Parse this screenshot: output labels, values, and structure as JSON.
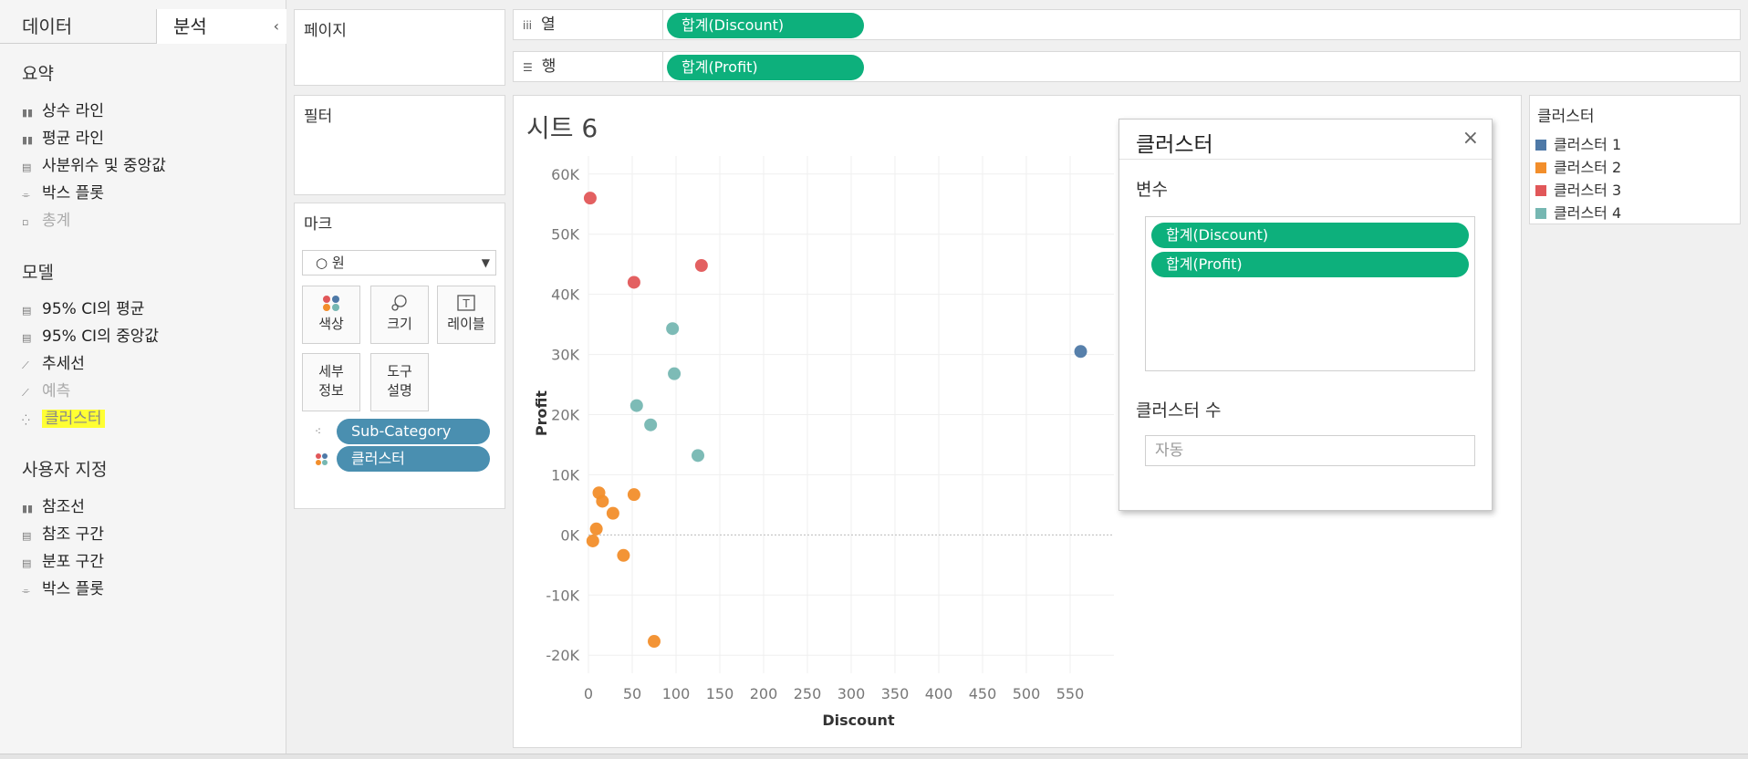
{
  "left_panel": {
    "tab_data": "데이터",
    "tab_analysis": "분석",
    "collapse": "‹",
    "summary": {
      "heading": "요약",
      "items": [
        {
          "label": "상수 라인",
          "enabled": true
        },
        {
          "label": "평균 라인",
          "enabled": true
        },
        {
          "label": "사분위수 및 중앙값",
          "enabled": true
        },
        {
          "label": "박스 플롯",
          "enabled": true
        },
        {
          "label": "총계",
          "enabled": false
        }
      ]
    },
    "model": {
      "heading": "모델",
      "items": [
        {
          "label": "95% CI의 평균",
          "enabled": true
        },
        {
          "label": "95% CI의 중앙값",
          "enabled": true
        },
        {
          "label": "추세선",
          "enabled": true
        },
        {
          "label": "예측",
          "enabled": false
        },
        {
          "label": "클러스터",
          "enabled": true,
          "highlighted": true
        }
      ]
    },
    "custom": {
      "heading": "사용자 지정",
      "items": [
        {
          "label": "참조선",
          "enabled": true
        },
        {
          "label": "참조 구간",
          "enabled": true
        },
        {
          "label": "분포 구간",
          "enabled": true
        },
        {
          "label": "박스 플롯",
          "enabled": true
        }
      ]
    }
  },
  "cards": {
    "pages": "페이지",
    "filters": "필터",
    "marks": {
      "title": "마크",
      "mark_type": "○ 원",
      "buttons": {
        "color": "색상",
        "size": "크기",
        "label": "레이블",
        "detail_1": "세부",
        "detail_2": "정보",
        "tooltip_1": "도구",
        "tooltip_2": "설명"
      },
      "pills": [
        "Sub-Category",
        "클러스터"
      ]
    }
  },
  "shelves": {
    "columns_label": "열",
    "columns_icon": "iii",
    "columns_pill": "합계(Discount)",
    "rows_label": "행",
    "rows_icon": "☰",
    "rows_pill": "합계(Profit)"
  },
  "sheet": {
    "title": "시트 6"
  },
  "legend": {
    "title": "클러스터",
    "items": [
      {
        "label": "클러스터 1",
        "color": "#4e79a7"
      },
      {
        "label": "클러스터 2",
        "color": "#f28e2b"
      },
      {
        "label": "클러스터 3",
        "color": "#e15759"
      },
      {
        "label": "클러스터 4",
        "color": "#76b7b2"
      }
    ]
  },
  "dialog": {
    "title": "클러스터",
    "close": "×",
    "variables_label": "변수",
    "variables": [
      "합계(Discount)",
      "합계(Profit)"
    ],
    "count_label": "클러스터 수",
    "count_placeholder": "자동"
  },
  "chart_data": {
    "type": "scatter",
    "xlabel": "Discount",
    "ylabel": "Profit",
    "xlim": [
      0,
      600
    ],
    "ylim": [
      -23000,
      63000
    ],
    "x_ticks": [
      "0",
      "50",
      "100",
      "150",
      "200",
      "250",
      "300",
      "350",
      "400",
      "450",
      "500",
      "550"
    ],
    "y_ticks": [
      "60K",
      "50K",
      "40K",
      "30K",
      "20K",
      "10K",
      "0K",
      "-10K",
      "-20K"
    ],
    "grid": true,
    "series": [
      {
        "name": "클러스터 1",
        "color": "#4e79a7",
        "points": [
          [
            562,
            30500
          ]
        ]
      },
      {
        "name": "클러스터 2",
        "color": "#f28e2b",
        "points": [
          [
            12,
            7000
          ],
          [
            16,
            5600
          ],
          [
            28,
            3600
          ],
          [
            52,
            6700
          ],
          [
            9,
            1000
          ],
          [
            5,
            -1000
          ],
          [
            40,
            -3400
          ],
          [
            75,
            -17700
          ]
        ]
      },
      {
        "name": "클러스터 3",
        "color": "#e15759",
        "points": [
          [
            2,
            56000
          ],
          [
            52,
            42000
          ],
          [
            129,
            44800
          ]
        ]
      },
      {
        "name": "클러스터 4",
        "color": "#76b7b2",
        "points": [
          [
            96,
            34300
          ],
          [
            98,
            26800
          ],
          [
            55,
            21500
          ],
          [
            71,
            18300
          ],
          [
            125,
            13200
          ]
        ]
      }
    ]
  }
}
